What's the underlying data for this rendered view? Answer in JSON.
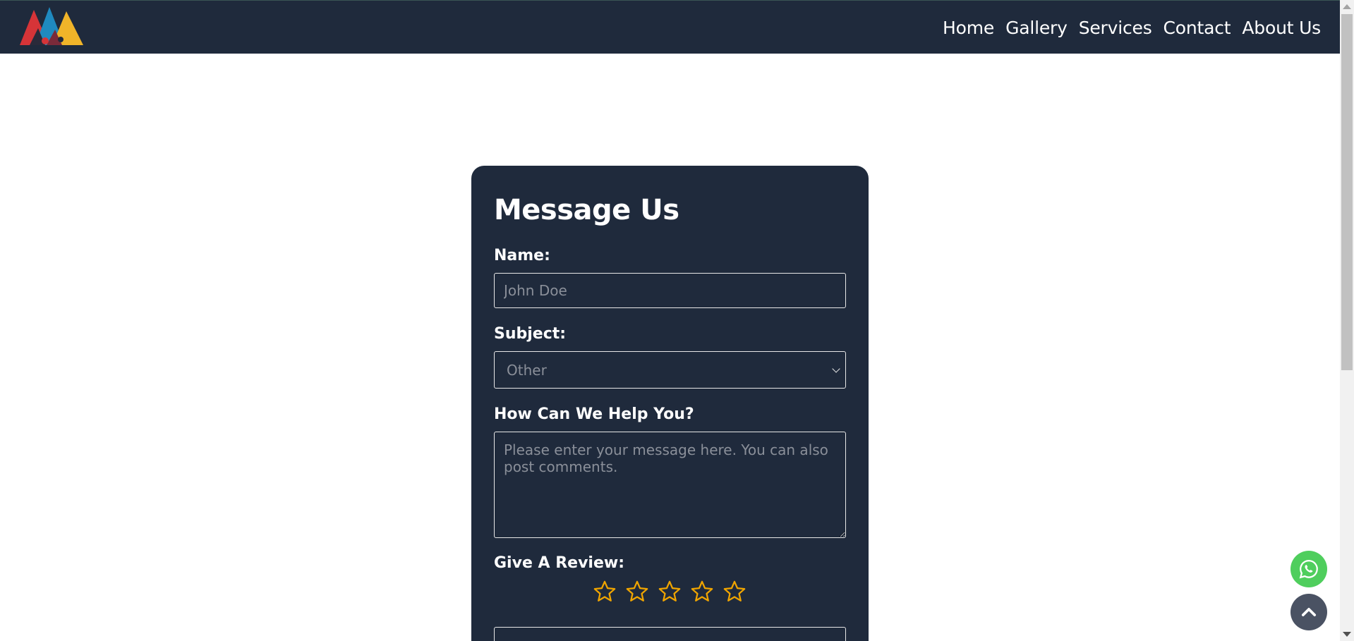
{
  "nav": {
    "links": [
      "Home",
      "Gallery",
      "Services",
      "Contact",
      "About Us"
    ],
    "logo_colors": [
      "#d63438",
      "#1f8ac0",
      "#f0b429"
    ]
  },
  "form": {
    "title": "Message Us",
    "name_label": "Name:",
    "name_placeholder": "John Doe",
    "subject_label": "Subject:",
    "subject_selected": "Other",
    "message_label": "How Can We Help You?",
    "message_placeholder": "Please enter your message here. You can also post comments.",
    "review_label": "Give A Review:",
    "star_count": 5,
    "rating": 0,
    "star_color": "#f0a500"
  },
  "icons": {
    "whatsapp": "whatsapp-icon",
    "back_to_top": "chevron-up-icon"
  },
  "colors": {
    "navbar_bg": "#1f2a3c",
    "card_bg": "#1f2a3c",
    "whatsapp_green": "#4fce5d",
    "back_to_top_bg": "#4a5263"
  }
}
